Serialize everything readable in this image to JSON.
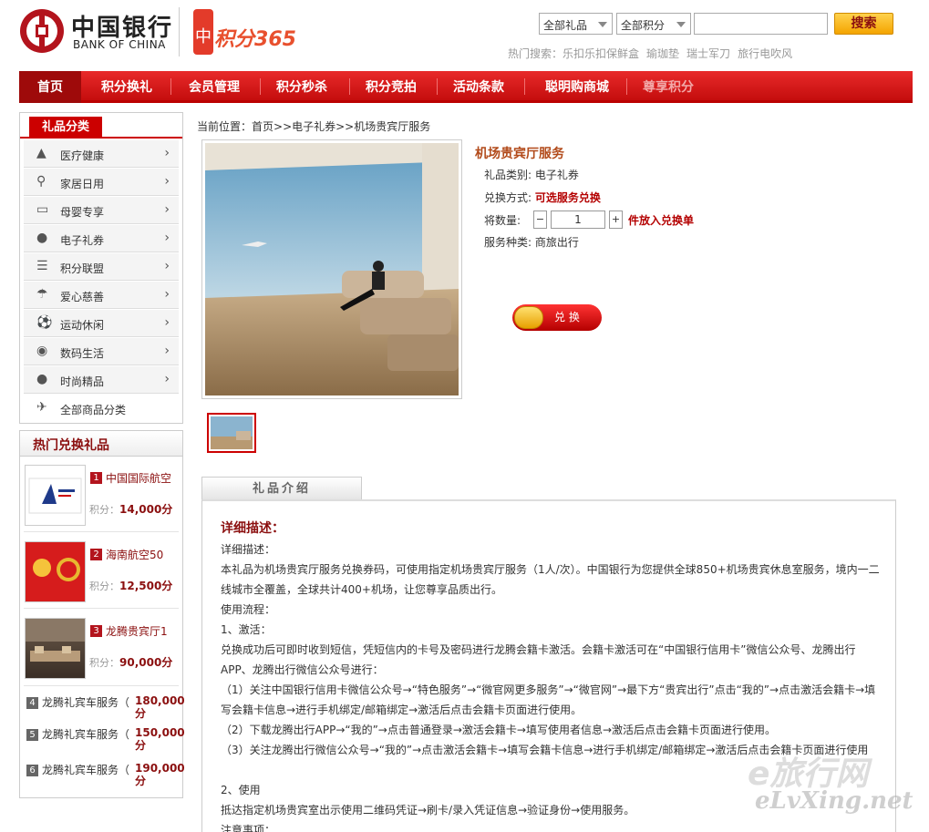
{
  "header": {
    "logo_cn": "中国银行",
    "logo_en": "BANK OF CHINA",
    "promo_logo_text": "积分365",
    "select_gift": "全部礼品",
    "select_points": "全部积分",
    "search_value": "",
    "search_button": "搜索",
    "hot_label": "热门搜索：",
    "hot_terms": [
      "乐扣乐扣保鲜盒",
      "瑜珈垫",
      "瑞士军刀",
      "旅行电吹风"
    ]
  },
  "nav": [
    "首页",
    "积分换礼",
    "会员管理",
    "积分秒杀",
    "积分竞拍",
    "活动条款",
    "聪明购商城",
    "尊享积分"
  ],
  "sidebar": {
    "title": "礼品分类",
    "categories": [
      {
        "label": "医疗健康",
        "icon": "medical-icon"
      },
      {
        "label": "家居日用",
        "icon": "home-goods-icon"
      },
      {
        "label": "母婴专享",
        "icon": "baby-icon"
      },
      {
        "label": "电子礼券",
        "icon": "ecoupon-icon"
      },
      {
        "label": "积分联盟",
        "icon": "alliance-icon"
      },
      {
        "label": "爱心慈善",
        "icon": "charity-icon"
      },
      {
        "label": "运动休闲",
        "icon": "sports-icon"
      },
      {
        "label": "数码生活",
        "icon": "digital-icon"
      },
      {
        "label": "时尚精品",
        "icon": "fashion-icon"
      },
      {
        "label": "全部商品分类",
        "icon": "plane-icon"
      }
    ],
    "hot_title": "热门兑换礼品",
    "hot_items": [
      {
        "rank": "1",
        "name": "中国国际航空",
        "points_label": "积分：",
        "points": "14,000分"
      },
      {
        "rank": "2",
        "name": "海南航空50",
        "points_label": "积分：",
        "points": "12,500分"
      },
      {
        "rank": "3",
        "name": "龙腾贵宾厅1",
        "points_label": "积分：",
        "points": "90,000分"
      }
    ],
    "hot_list": [
      {
        "rank": "4",
        "name": "龙腾礼宾车服务（",
        "points": "180,000分"
      },
      {
        "rank": "5",
        "name": "龙腾礼宾车服务（",
        "points": "150,000分"
      },
      {
        "rank": "6",
        "name": "龙腾礼宾车服务（",
        "points": "190,000分"
      }
    ]
  },
  "breadcrumb": {
    "prefix": "当前位置：",
    "path": "首页>>电子礼券>>机场贵宾厅服务"
  },
  "product": {
    "title": "机场贵宾厅服务",
    "category_label": "礼品类别:",
    "category": "电子礼券",
    "exchange_label": "兑换方式:",
    "exchange": "可选服务兑换",
    "qty_label": "将数量:",
    "minus": "−",
    "qty": "1",
    "plus": "+",
    "add_to_list": "件放入兑换单",
    "service_label": "服务种类:",
    "service": "商旅出行",
    "redeem_button": "兑 换"
  },
  "intro": {
    "tab": "礼品介绍",
    "heading": "详细描述：",
    "lines": [
      "详细描述：",
      "本礼品为机场贵宾厅服务兑换券码，可使用指定机场贵宾厅服务（1人/次）。中国银行为您提供全球850+机场贵宾休息室服务，境内一二线城市全覆盖，全球共计400+机场，让您尊享品质出行。",
      "使用流程：",
      "1、激活：",
      "兑换成功后可即时收到短信，凭短信内的卡号及密码进行龙腾会籍卡激活。会籍卡激活可在“中国银行信用卡”微信公众号、龙腾出行APP、龙腾出行微信公众号进行：",
      "（1）关注中国银行信用卡微信公众号→“特色服务”→“微官网更多服务”→“微官网”→最下方“贵宾出行”点击“我的”→点击激活会籍卡→填写会籍卡信息→进行手机绑定/邮箱绑定→激活后点击会籍卡页面进行使用。",
      "（2）下载龙腾出行APP→“我的”→点击普通登录→激活会籍卡→填写使用者信息→激活后点击会籍卡页面进行使用。",
      "（3）关注龙腾出行微信公众号→“我的”→点击激活会籍卡→填写会籍卡信息→进行手机绑定/邮箱绑定→激活后点击会籍卡页面进行使用",
      "2、使用",
      "抵达指定机场贵宾室出示使用二维码凭证→刷卡/录入凭证信息→验证身份→使用服务。",
      "注意事项："
    ]
  },
  "watermark": {
    "top": "e旅行网",
    "bottom": "eLvXing.net"
  }
}
